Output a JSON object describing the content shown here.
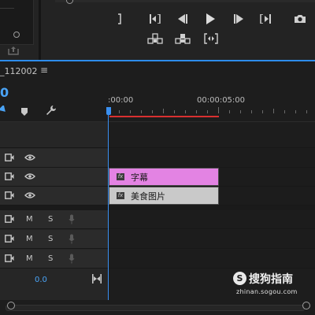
{
  "source_monitor": {
    "export_icon": "export-frame-icon"
  },
  "program_monitor": {
    "transport_row1": [
      {
        "name": "mark-in-icon"
      },
      {
        "name": "go-to-in-icon"
      },
      {
        "name": "step-back-icon"
      },
      {
        "name": "play-icon"
      },
      {
        "name": "step-forward-icon"
      },
      {
        "name": "go-to-out-icon"
      },
      {
        "name": "camera-icon"
      }
    ],
    "transport_row2": [
      {
        "name": "lift-icon"
      },
      {
        "name": "extract-icon"
      },
      {
        "name": "trim-icon"
      }
    ]
  },
  "timeline": {
    "sequence_name": "_112002",
    "menu_glyph": "≡",
    "timecode_partial": "0",
    "ruler_labels": [
      ":00:00",
      "00:00:05:00"
    ],
    "master_volume": "0.0"
  },
  "tracks": {
    "video": [
      {
        "id": "v3"
      },
      {
        "id": "v2",
        "clip": {
          "label": "字幕",
          "kind": "text"
        }
      },
      {
        "id": "v1",
        "clip": {
          "label": "美食图片",
          "kind": "image"
        }
      }
    ],
    "audio": [
      {
        "id": "a1",
        "mute": "M",
        "solo": "S"
      },
      {
        "id": "a2",
        "mute": "M",
        "solo": "S"
      },
      {
        "id": "a3",
        "mute": "M",
        "solo": "S"
      }
    ]
  },
  "colors": {
    "accent": "#2d8ceb",
    "work_area": "#d93030",
    "text_clip": "#e383e3",
    "image_clip": "#c9c9c9"
  },
  "watermark": {
    "name": "搜狗指南",
    "url": "zhinan.sogou.com"
  }
}
